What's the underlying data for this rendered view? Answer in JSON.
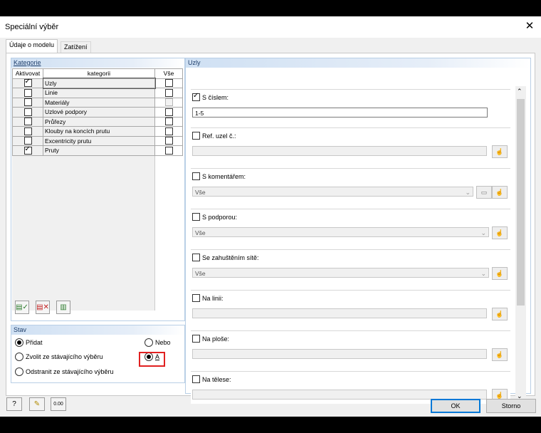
{
  "window": {
    "title": "Speciální výběr",
    "close": "✕"
  },
  "tabs": [
    {
      "label": "Údaje o modelu"
    },
    {
      "label": "Zatížení"
    }
  ],
  "kategorie": {
    "title": "Kategorie",
    "headers": {
      "activate": "Aktivovat",
      "category": "kategorii",
      "all": "Vše"
    },
    "rows": [
      {
        "activate": true,
        "label": "Uzly",
        "all": false,
        "all_disabled": false
      },
      {
        "activate": false,
        "label": "Linie",
        "all": false,
        "all_disabled": false
      },
      {
        "activate": false,
        "label": "Materiály",
        "all": false,
        "all_disabled": true
      },
      {
        "activate": false,
        "label": "Uzlové podpory",
        "all": false,
        "all_disabled": false
      },
      {
        "activate": false,
        "label": "Průřezy",
        "all": false,
        "all_disabled": false
      },
      {
        "activate": false,
        "label": "Klouby na koncích prutu",
        "all": false,
        "all_disabled": false
      },
      {
        "activate": false,
        "label": "Excentricity prutu",
        "all": false,
        "all_disabled": false
      },
      {
        "activate": true,
        "label": "Pruty",
        "all": false,
        "all_disabled": false
      }
    ],
    "tool_icons": [
      "select-all-icon",
      "deselect-all-icon",
      "invert-selection-icon"
    ]
  },
  "stav": {
    "title": "Stav",
    "options": {
      "pridat": "Přidat",
      "zvolit": "Zvolit ze stávajícího výběru",
      "odstranit": "Odstranit ze stávajícího výběru",
      "nebo": "Nebo",
      "a": "A"
    },
    "selected": "pridat",
    "logic_selected": "a"
  },
  "uzly": {
    "title": "Uzly",
    "sections": [
      {
        "label": "S číslem:",
        "checked": true,
        "value": "1-5",
        "type": "text"
      },
      {
        "label": "Ref. uzel č.:",
        "checked": false,
        "value": "",
        "type": "text-pick"
      },
      {
        "label": "S komentářem:",
        "checked": false,
        "value": "Vše",
        "type": "combo-2btn"
      },
      {
        "label": "S podporou:",
        "checked": false,
        "value": "Vše",
        "type": "combo-pick"
      },
      {
        "label": "Se zahuštěním sítě:",
        "checked": false,
        "value": "Vše",
        "type": "combo-pick"
      },
      {
        "label": "Na linii:",
        "checked": false,
        "value": "",
        "type": "text-pick"
      },
      {
        "label": "Na ploše:",
        "checked": false,
        "value": "",
        "type": "text-pick"
      },
      {
        "label": "Na tělese:",
        "checked": false,
        "value": "",
        "type": "text-pick"
      }
    ]
  },
  "footer": {
    "ok": "OK",
    "cancel": "Storno",
    "icons": [
      "help-icon",
      "edit-icon",
      "units-icon"
    ],
    "units_text": "0.00"
  },
  "colors": {
    "accent": "#0078d7",
    "highlight": "#e02020",
    "group_header": "#cfe0f3"
  }
}
